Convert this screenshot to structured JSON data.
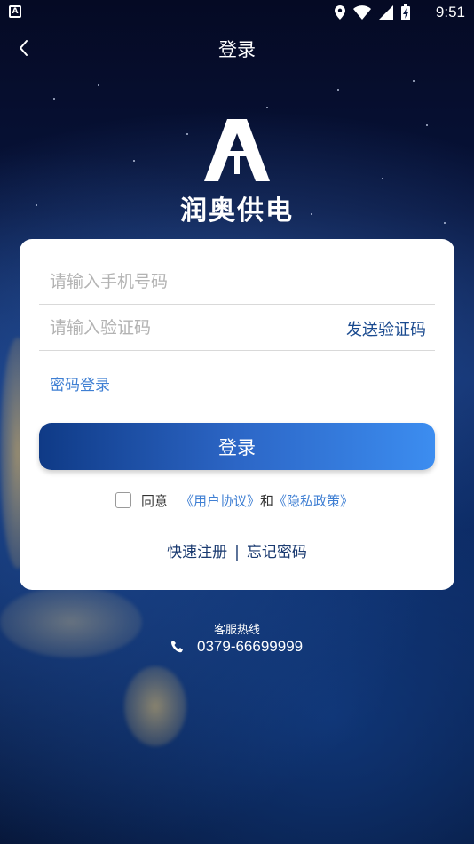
{
  "status_bar": {
    "time": "9:51",
    "app_badge": "A"
  },
  "header": {
    "title": "登录",
    "back_icon": "chevron-left-icon"
  },
  "logo": {
    "brand_name": "润奥供电"
  },
  "form": {
    "phone_placeholder": "请输入手机号码",
    "phone_value": "",
    "code_placeholder": "请输入验证码",
    "code_value": "",
    "send_code_label": "发送验证码",
    "password_login_label": "密码登录",
    "login_button_label": "登录",
    "agreement": {
      "checked": false,
      "prefix": "同意",
      "user_agreement": "《用户协议》",
      "and": "和",
      "privacy_policy": "《隐私政策》"
    },
    "register_label": "快速注册",
    "separator": "|",
    "forgot_password_label": "忘记密码"
  },
  "hotline": {
    "label": "客服热线",
    "number": "0379-66699999"
  },
  "colors": {
    "accent": "#3f7fd3",
    "button_start": "#0f3a86",
    "button_end": "#3c8df0",
    "dark_link": "#1a3a70"
  }
}
